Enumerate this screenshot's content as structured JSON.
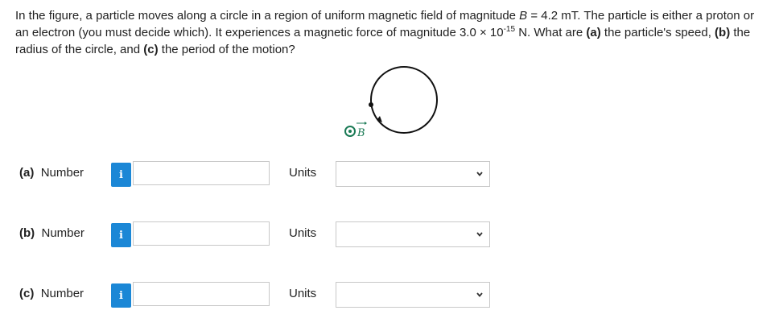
{
  "question": {
    "prefix": "In the figure, a particle moves along a circle in a region of uniform magnetic field of magnitude ",
    "b_symbol": "B",
    "b_value": " = 4.2 mT. The particle is either a proton or an electron (you must decide which). It experiences a magnetic force of magnitude 3.0 × 10",
    "exponent": "-15",
    "after_exponent": " N. What are ",
    "part_a_tag": "(a)",
    "part_a_text": " the particle's speed, ",
    "part_b_tag": "(b)",
    "part_b_text": " the radius of the circle, and ",
    "part_c_tag": "(c)",
    "part_c_text": " the period of the motion?"
  },
  "figure": {
    "field_label": "B"
  },
  "rows": [
    {
      "tag": "(a)",
      "label": "Number",
      "info": "i",
      "value": "",
      "units_label": "Units",
      "units_value": ""
    },
    {
      "tag": "(b)",
      "label": "Number",
      "info": "i",
      "value": "",
      "units_label": "Units",
      "units_value": ""
    },
    {
      "tag": "(c)",
      "label": "Number",
      "info": "i",
      "value": "",
      "units_label": "Units",
      "units_value": ""
    }
  ],
  "colors": {
    "info_button": "#1b87d6",
    "field_symbol": "#1a7a55"
  }
}
